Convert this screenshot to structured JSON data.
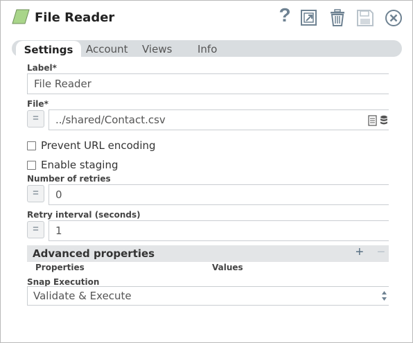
{
  "header": {
    "title": "File Reader",
    "icons": [
      "snap-type-icon",
      "help-icon",
      "expand-icon",
      "trash-icon",
      "save-icon",
      "close-icon"
    ],
    "help_glyph": "?"
  },
  "tabs": [
    {
      "label": "Settings",
      "active": true
    },
    {
      "label": "Account",
      "active": false
    },
    {
      "label": "Views",
      "active": false
    },
    {
      "label": "Info",
      "active": false
    }
  ],
  "form": {
    "label_field": {
      "label": "Label*",
      "value": "File Reader"
    },
    "file_field": {
      "label": "File*",
      "value": "../shared/Contact.csv",
      "expr_glyph": "="
    },
    "prevent_url_encoding": {
      "label": "Prevent URL encoding",
      "checked": false
    },
    "enable_staging": {
      "label": "Enable staging",
      "checked": false
    },
    "retries": {
      "label": "Number of retries",
      "value": "0",
      "expr_glyph": "="
    },
    "retry_interval": {
      "label": "Retry interval (seconds)",
      "value": "1",
      "expr_glyph": "="
    },
    "advanced": {
      "title": "Advanced properties",
      "add_glyph": "+",
      "remove_glyph": "−",
      "columns": [
        "Properties",
        "Values"
      ]
    },
    "snap_execution": {
      "label": "Snap Execution",
      "value": "Validate & Execute"
    }
  },
  "colors": {
    "accent_green": "#9ccc78",
    "icon_gray": "#6e8292",
    "tab_bar": "#d9dde0"
  }
}
